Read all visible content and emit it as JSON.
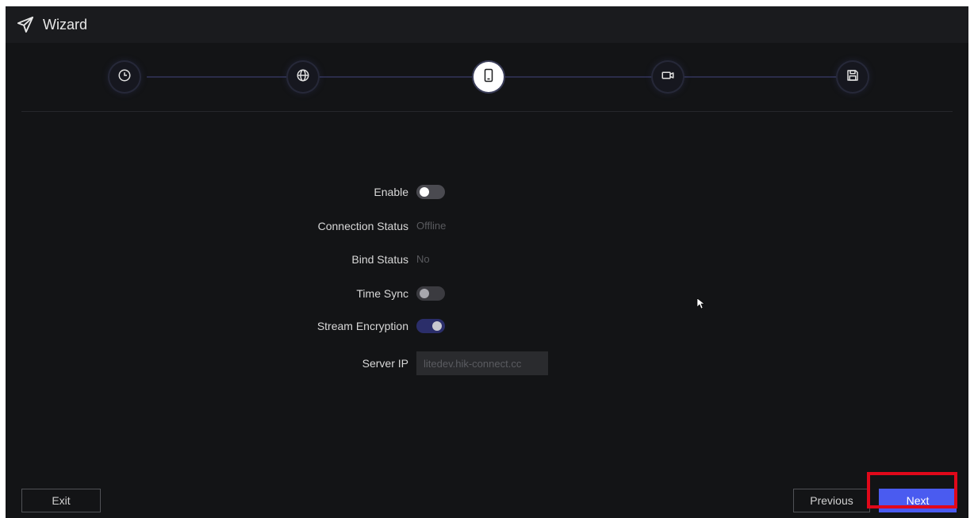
{
  "titlebar": {
    "title": "Wizard",
    "icon": "paper-plane-icon"
  },
  "steps": [
    {
      "icon": "clock-icon",
      "state": "done"
    },
    {
      "icon": "globe-icon",
      "state": "done"
    },
    {
      "icon": "mobile-icon",
      "state": "active"
    },
    {
      "icon": "camera-icon",
      "state": "pending"
    },
    {
      "icon": "save-icon",
      "state": "pending"
    }
  ],
  "form": {
    "enable": {
      "label": "Enable",
      "state": "off"
    },
    "connection_status": {
      "label": "Connection Status",
      "value": "Offline"
    },
    "bind_status": {
      "label": "Bind Status",
      "value": "No"
    },
    "time_sync": {
      "label": "Time Sync",
      "state": "off"
    },
    "stream_encryption": {
      "label": "Stream Encryption",
      "state": "on"
    },
    "server_ip": {
      "label": "Server IP",
      "value": "litedev.hik-connect.cc"
    }
  },
  "footer": {
    "exit_label": "Exit",
    "previous_label": "Previous",
    "next_label": "Next"
  },
  "colors": {
    "primary": "#4a5bf0",
    "highlight": "#e0081a",
    "background": "#131416"
  }
}
